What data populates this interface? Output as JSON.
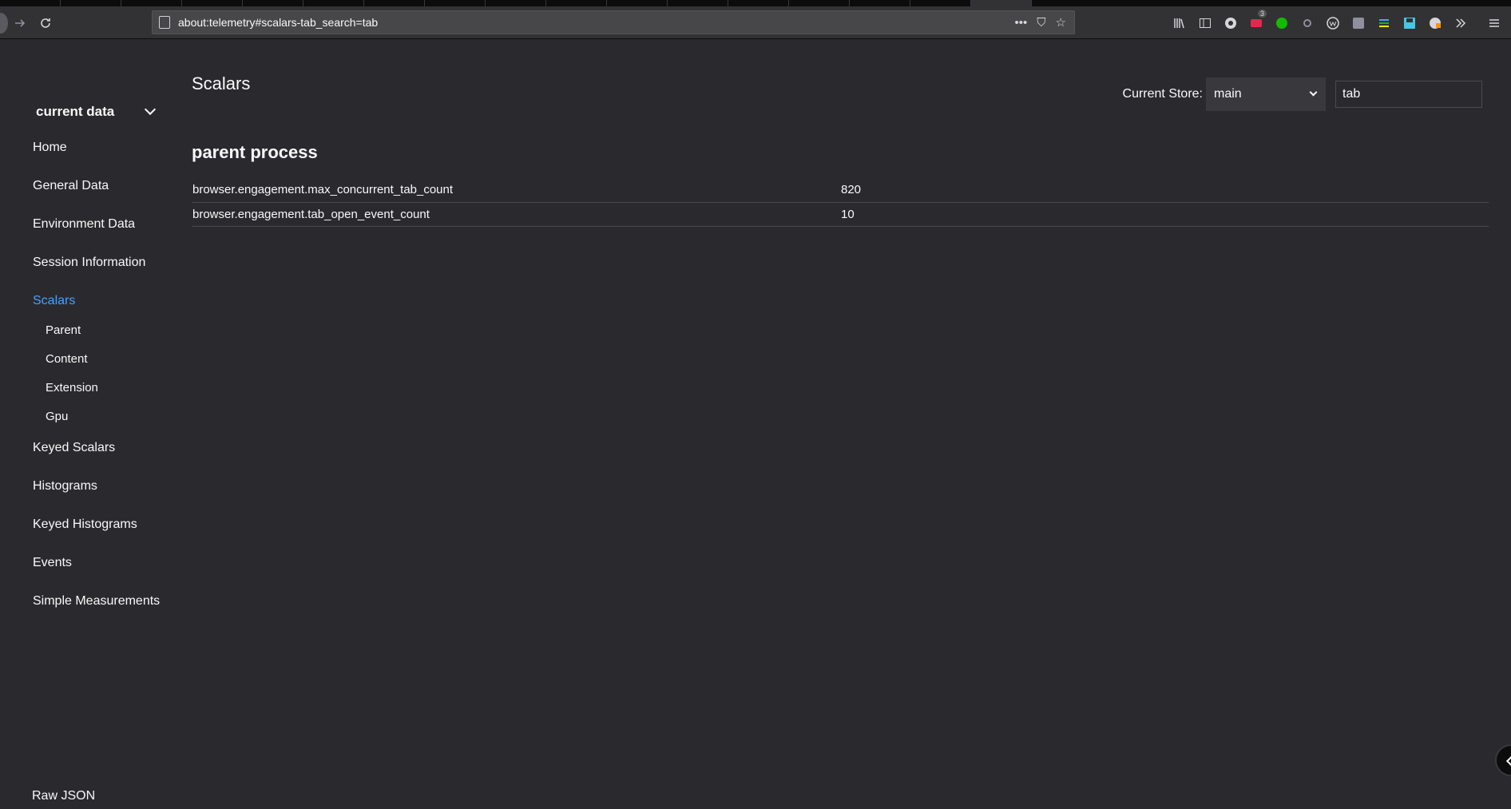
{
  "browser": {
    "url": "about:telemetry#scalars-tab_search=tab",
    "page_actions": {
      "more": "•••",
      "pocket": "⛉",
      "bookmark": "☆"
    },
    "toolbar_icons": [
      "library-icon",
      "sidebar-icon",
      "extension-icon",
      "extension-badge-icon",
      "extension-green-icon",
      "extension-gear-icon",
      "extension-w-icon",
      "extension-box-icon",
      "extension-stack-icon",
      "save-icon",
      "extension-lock-icon",
      "overflow-icon",
      "menu-icon"
    ],
    "badge_count": "3"
  },
  "sidebar": {
    "category": "current data",
    "items": [
      {
        "label": "Home"
      },
      {
        "label": "General Data"
      },
      {
        "label": "Environment Data"
      },
      {
        "label": "Session Information"
      },
      {
        "label": "Scalars",
        "active": true
      },
      {
        "label": "Keyed Scalars"
      },
      {
        "label": "Histograms"
      },
      {
        "label": "Keyed Histograms"
      },
      {
        "label": "Events"
      },
      {
        "label": "Simple Measurements"
      }
    ],
    "subitems": [
      {
        "label": "Parent"
      },
      {
        "label": "Content"
      },
      {
        "label": "Extension"
      },
      {
        "label": "Gpu"
      }
    ],
    "raw_json": "Raw JSON"
  },
  "main": {
    "title": "Scalars",
    "store_label": "Current Store:",
    "store_value": "main",
    "search_value": "tab",
    "section_title": "parent process",
    "rows": [
      {
        "key": "browser.engagement.max_concurrent_tab_count",
        "value": "820"
      },
      {
        "key": "browser.engagement.tab_open_event_count",
        "value": "10"
      }
    ]
  },
  "colors": {
    "background": "#2a2a2e",
    "accent": "#45a1ff",
    "text": "#f9f9fa"
  }
}
